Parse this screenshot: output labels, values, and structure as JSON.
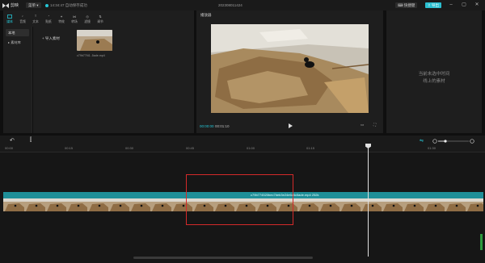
{
  "titlebar": {
    "app_name": "剪映",
    "menu_label": "菜单",
    "status_text": "14:34:47 自动保存成功",
    "project_title": "202308011424",
    "shortcut_label": "快捷键",
    "export_label": "导出"
  },
  "toolbar_tabs": [
    {
      "label": "媒体",
      "icon": "media-icon"
    },
    {
      "label": "音频",
      "icon": "audio-icon"
    },
    {
      "label": "文本",
      "icon": "text-icon"
    },
    {
      "label": "贴纸",
      "icon": "sticker-icon"
    },
    {
      "label": "特效",
      "icon": "effects-icon"
    },
    {
      "label": "转场",
      "icon": "transition-icon"
    },
    {
      "label": "滤镜",
      "icon": "filter-icon"
    },
    {
      "label": "调节",
      "icon": "adjust-icon"
    }
  ],
  "sidebar": {
    "items": [
      {
        "label": "本地"
      },
      {
        "label": "▸ 素材库"
      }
    ]
  },
  "media": {
    "import_label": "导入素材",
    "clip_name": "c79b77f41..5ade.mp4"
  },
  "player": {
    "title": "播放器",
    "current_time": "00:00:00",
    "duration": "00:01:10",
    "ratio_label": "比例"
  },
  "properties": {
    "empty_line1": "当前未选中时间",
    "empty_line2": "线上的素材"
  },
  "timeline": {
    "ticks": [
      "00:00",
      "00:15",
      "00:30",
      "00:45",
      "01:00",
      "01:15",
      "01:30"
    ],
    "clip_label": "c79b774520bec7beb3e24e6c6c5ade.mp4   252k"
  },
  "colors": {
    "accent": "#25c6d6",
    "track": "#1f8f98",
    "highlight_box": "#d42a2a",
    "export_button": "#2bbfd0"
  }
}
